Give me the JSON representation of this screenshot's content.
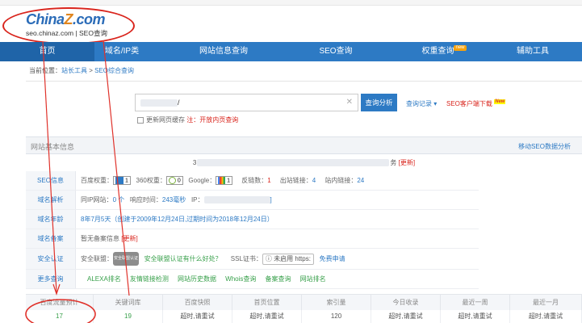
{
  "logo": {
    "main_a": "China",
    "main_z": "Z",
    "main_b": ".com",
    "sub": "seo.chinaz.com | SEO查询"
  },
  "nav": [
    {
      "label": "首页"
    },
    {
      "label": "域名/IP类"
    },
    {
      "label": "网站信息查询"
    },
    {
      "label": "SEO查询"
    },
    {
      "label": "权重查询",
      "badge": "new"
    },
    {
      "label": "辅助工具"
    }
  ],
  "breadcrumb": {
    "prefix": "当前位置：",
    "item1": "站长工具",
    "sep": " > ",
    "item2": "SEO综合查询"
  },
  "search": {
    "value": "/",
    "button": "查询分析",
    "history": "查询记录 ▾",
    "download": "SEO客户端下载",
    "download_tag": "New",
    "cache_label": "更新网页缓存",
    "cache_note": "注：开放内页查询"
  },
  "panel": {
    "title": "网站基本信息",
    "link": "移动SEO数据分析"
  },
  "site_line": {
    "a": "3",
    "b": "务",
    "update": "[更新]"
  },
  "rows": {
    "seo": {
      "label": "SEO信息",
      "baidu": "百度权重：",
      "baidu_val": "1",
      "s360": "360权重：",
      "s360_val": "0",
      "google": "Google：",
      "google_val": "1",
      "backlinks": "反链数：",
      "backlinks_val": "1",
      "outlinks": "出站链接：",
      "outlinks_val": "4",
      "inlinks": "站内链接：",
      "inlinks_val": "24"
    },
    "domain": {
      "label": "域名解析",
      "sameip": "同IP网站：",
      "sameip_val": "0 个",
      "resp": "响应时间：",
      "resp_val": "243毫秒",
      "ip": "IP："
    },
    "age": {
      "label": "域名年龄",
      "value": "8年7月5天（创建于2009年12月24日,过期时间为2018年12月24日）"
    },
    "beian": {
      "label": "域名备案",
      "value": "暂无备案信息",
      "update": "[更新]"
    },
    "security": {
      "label": "安全认证",
      "alliance": "安全联盟：",
      "seal": "安全联盟认证",
      "ask": "安全联盟认证有什么好处？",
      "ssl_label": "SSL证书：",
      "ssl_val": "ⓘ 未启用 https:",
      "free": "免费申请"
    },
    "more": {
      "label": "更多查询",
      "links": [
        "ALEXA排名",
        "友情链接检测",
        "网站历史数据",
        "Whois查询",
        "备案查询",
        "网站排名"
      ]
    }
  },
  "table": {
    "headers": [
      "百度流量预计",
      "关键词库",
      "百度快照",
      "首页位置",
      "索引量",
      "今日收录",
      "最近一周",
      "最近一月"
    ],
    "values": [
      "17",
      "19",
      "超时,请重试",
      "超时,请重试",
      "120",
      "超时,请重试",
      "超时,请重试",
      "超时,请重试"
    ]
  },
  "colors": {
    "nav": "#2d7ac4",
    "accent_red": "#d9241c",
    "green": "#38a04b"
  }
}
